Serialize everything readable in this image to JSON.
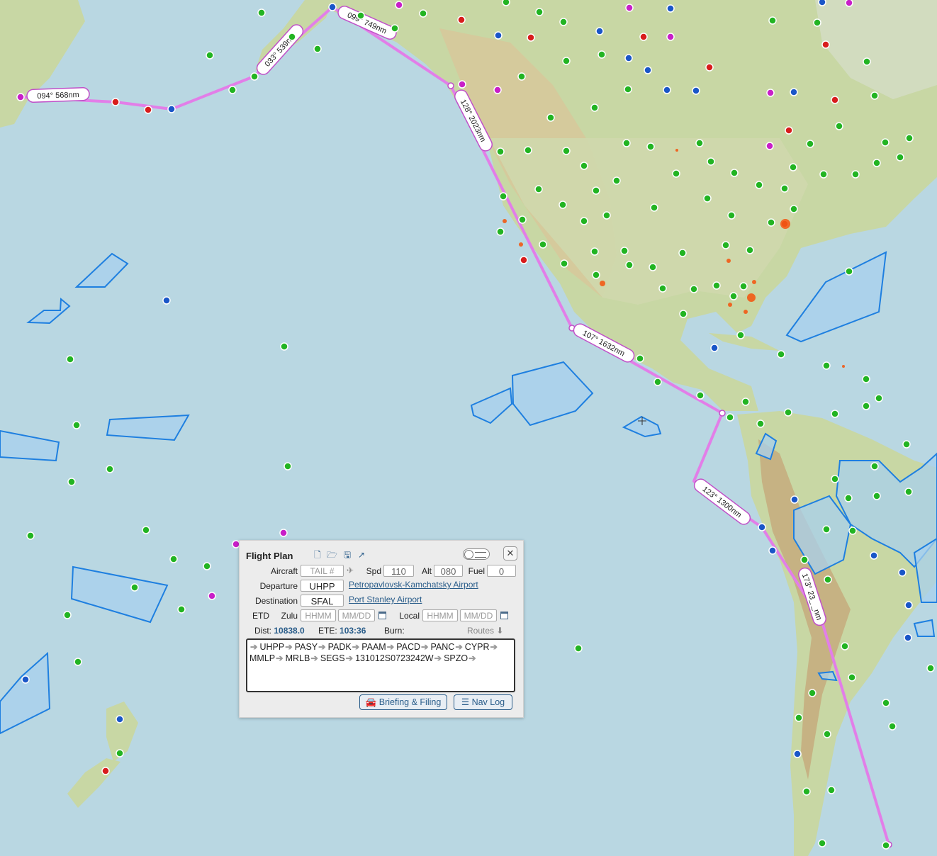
{
  "map": {
    "route_labels": [
      {
        "text": "094° 568nm"
      },
      {
        "text": "033° 539nm"
      },
      {
        "text": "099° 749nm"
      },
      {
        "text": "128° 2023nm"
      },
      {
        "text": "107° 1632nm"
      },
      {
        "text": "123° 1300nm"
      },
      {
        "text": "173° 23_ _nm"
      }
    ],
    "colors": {
      "ocean": "#b9d7e2",
      "land": "#c9d9a8",
      "route": "#e27ee8",
      "airspace_fill": "#a8d0ee",
      "airspace_stroke": "#1e7fe0",
      "vfr": "#22b422",
      "mvfr": "#1a56c8",
      "ifr": "#d81c1c",
      "lifr": "#c81fc8"
    }
  },
  "flight_plan": {
    "title": "Flight Plan",
    "icons": [
      "new-file-icon",
      "open-folder-icon",
      "save-icon",
      "share-icon"
    ],
    "aircraft_label": "Aircraft",
    "aircraft_placeholder": "TAIL #",
    "spd_label": "Spd",
    "spd_value": "110",
    "alt_label": "Alt",
    "alt_value": "080",
    "fuel_label": "Fuel",
    "fuel_value": "0",
    "departure_label": "Departure",
    "departure_code": "UHPP",
    "departure_name": "Petropavlovsk-Kamchatsky Airport",
    "destination_label": "Destination",
    "destination_code": "SFAL",
    "destination_name": "Port Stanley Airport",
    "etd_label": "ETD",
    "zulu_label": "Zulu",
    "local_label": "Local",
    "time_placeholder": "HHMM",
    "date_placeholder": "MM/DD",
    "dist_label": "Dist:",
    "dist_value": "10838.0",
    "ete_label": "ETE:",
    "ete_value": "103:36",
    "burn_label": "Burn:",
    "routes_label": "Routes",
    "route": [
      "UHPP",
      "PASY",
      "PADK",
      "PAAM",
      "PACD",
      "PANC",
      "CYPR",
      "MMLP",
      "MRLB",
      "SEGS",
      "131012S0723242W",
      "SPZO"
    ],
    "briefing_button": "Briefing & Filing",
    "navlog_button": "Nav Log"
  }
}
